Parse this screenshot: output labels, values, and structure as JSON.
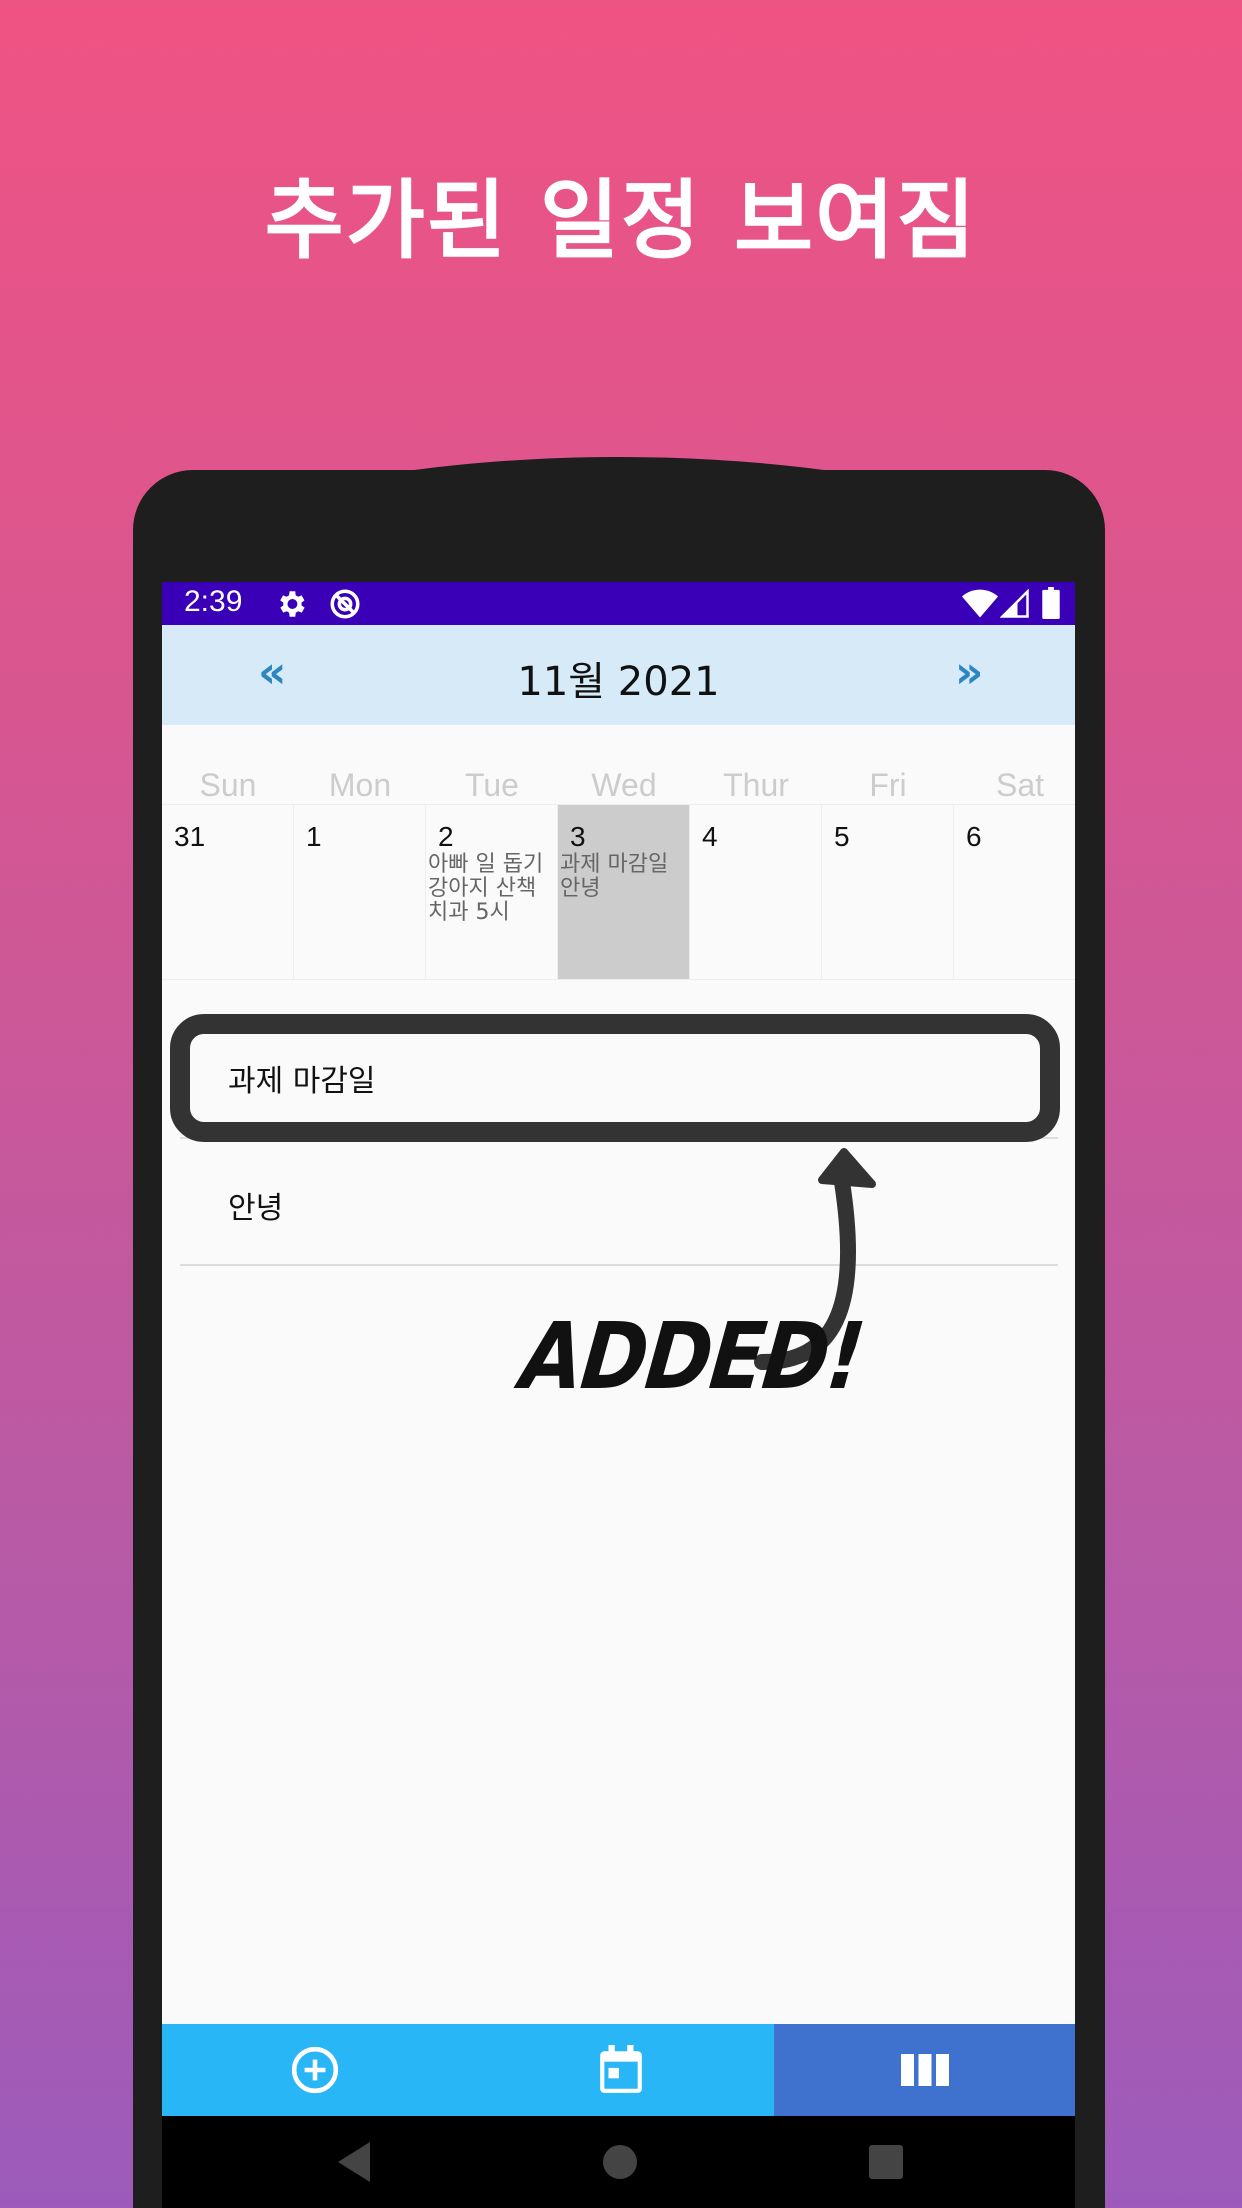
{
  "headline": "추가된 일정 보여짐",
  "status_bar": {
    "time": "2:39"
  },
  "calendar": {
    "prev_label": "«",
    "next_label": "»",
    "month_title": "11월 2021",
    "weekdays": [
      "Sun",
      "Mon",
      "Tue",
      "Wed",
      "Thur",
      "Fri",
      "Sat"
    ],
    "days": [
      {
        "num": "31",
        "events": ""
      },
      {
        "num": "1",
        "events": ""
      },
      {
        "num": "2",
        "events": "아빠 일 돕기\n강아지 산책\n치과 5시"
      },
      {
        "num": "3",
        "events": "과제 마감일\n안녕"
      },
      {
        "num": "4",
        "events": ""
      },
      {
        "num": "5",
        "events": ""
      },
      {
        "num": "6",
        "events": ""
      }
    ]
  },
  "event_list": [
    {
      "text": "과제 마감일"
    },
    {
      "text": "안녕"
    }
  ],
  "annotation": {
    "label": "ADDED!"
  },
  "colors": {
    "status_bar": "#3a00b8",
    "month_header": "#d6eaf8",
    "nav_arrow": "#2e86c1",
    "selected_day": "#cccccc",
    "bottom_bar": "#29b6f6",
    "bottom_bar_active": "#3f72cf"
  },
  "icons": [
    "gear-icon",
    "sync-icon",
    "wifi-icon",
    "signal-icon",
    "battery-icon",
    "add-circle-icon",
    "calendar-icon",
    "columns-icon",
    "back-icon",
    "home-icon",
    "recents-icon"
  ]
}
